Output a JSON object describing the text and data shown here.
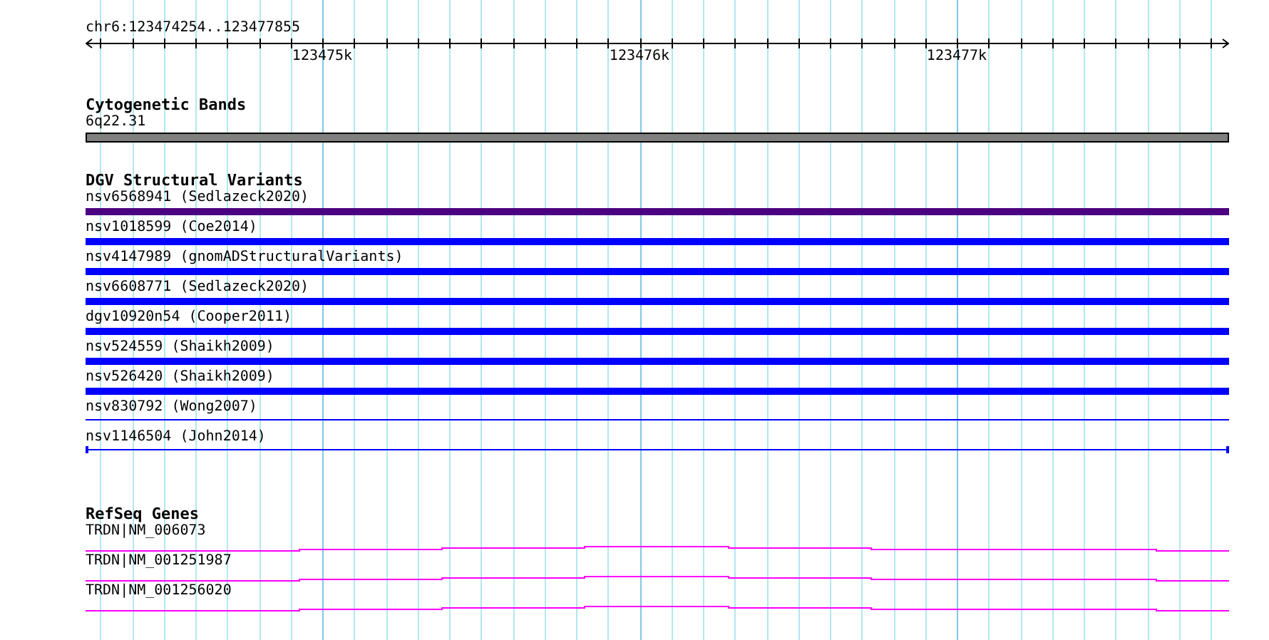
{
  "locus": "chr6:123474254..123477855",
  "ruler": {
    "ticks": [
      {
        "label": "123475k"
      },
      {
        "label": "123476k"
      },
      {
        "label": "123477k"
      }
    ]
  },
  "tracks": [
    {
      "title": "Cytogenetic Bands",
      "features": [
        {
          "label": "6q22.31",
          "kind": "band"
        }
      ]
    },
    {
      "title": "DGV Structural Variants",
      "features": [
        {
          "label": "nsv6568941 (Sedlazeck2020)",
          "kind": "thick",
          "color": "#4b0082"
        },
        {
          "label": "nsv1018599 (Coe2014)",
          "kind": "thick",
          "color": "#0000ff"
        },
        {
          "label": "nsv4147989 (gnomADStructuralVariants)",
          "kind": "thick",
          "color": "#0000ff"
        },
        {
          "label": "nsv6608771 (Sedlazeck2020)",
          "kind": "thick",
          "color": "#0000ff"
        },
        {
          "label": "dgv10920n54 (Cooper2011)",
          "kind": "thick",
          "color": "#0000ff"
        },
        {
          "label": "nsv524559 (Shaikh2009)",
          "kind": "thick",
          "color": "#0000ff"
        },
        {
          "label": "nsv526420 (Shaikh2009)",
          "kind": "thick",
          "color": "#0000ff"
        },
        {
          "label": "nsv830792 (Wong2007)",
          "kind": "thin",
          "color": "#0000ff"
        },
        {
          "label": "nsv1146504 (John2014)",
          "kind": "bounded",
          "color": "#0000ff"
        }
      ]
    },
    {
      "title": "RefSeq Genes",
      "features": [
        {
          "label": "TRDN|NM_006073",
          "kind": "gene"
        },
        {
          "label": "TRDN|NM_001251987",
          "kind": "gene"
        },
        {
          "label": "TRDN|NM_001256020",
          "kind": "gene"
        }
      ]
    }
  ]
}
